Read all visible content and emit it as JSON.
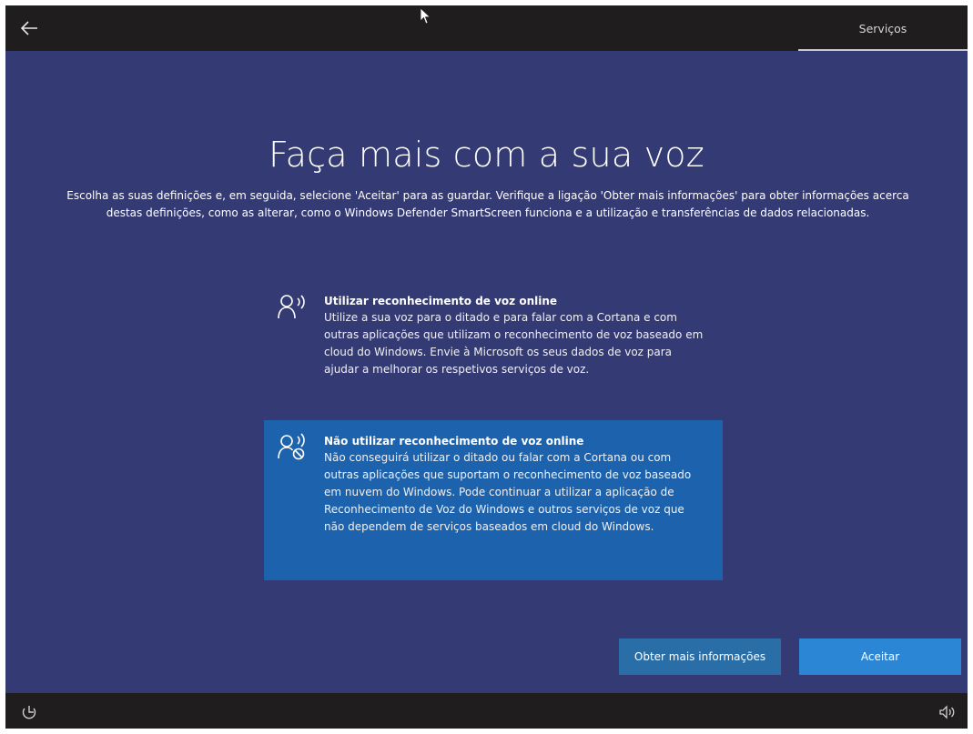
{
  "topbar": {
    "back_icon": "arrow-left-icon",
    "tab_label": "Serviços"
  },
  "page": {
    "title": "Faça mais com a sua voz",
    "subtitle": "Escolha as suas definições e, em seguida, selecione 'Aceitar' para as guardar. Verifique a ligação 'Obter mais informações' para obter informações acerca destas definições, como as alterar, como o Windows Defender SmartScreen funciona e a utilização e transferências de dados relacionadas."
  },
  "options": [
    {
      "icon": "speech-person-icon",
      "title": "Utilizar reconhecimento de voz online",
      "description": "Utilize a sua voz para o ditado e para falar com a Cortana e com outras aplicações que utilizam o reconhecimento de voz baseado em cloud do Windows. Envie à Microsoft os seus dados de voz para ajudar a melhorar os respetivos serviços de voz.",
      "selected": false
    },
    {
      "icon": "speech-person-blocked-icon",
      "title": "Não utilizar reconhecimento de voz online",
      "description": "Não conseguirá utilizar o ditado ou falar com a Cortana ou com outras aplicações que suportam o reconhecimento de voz baseado em nuvem do Windows. Pode continuar a utilizar a aplicação de Reconhecimento de Voz do Windows e outros serviços de voz que não dependem de serviços baseados em cloud do Windows.",
      "selected": true
    }
  ],
  "buttons": {
    "info_label": "Obter mais informações",
    "accept_label": "Aceitar"
  },
  "bottombar": {
    "ease_icon": "ease-of-access-icon",
    "volume_icon": "volume-icon"
  },
  "colors": {
    "main_bg": "#343a73",
    "selected_option": "#1d62ac",
    "accept_button": "#2b87d6",
    "info_button": "#2a6ea7",
    "bar_bg": "#1f1d1d"
  }
}
